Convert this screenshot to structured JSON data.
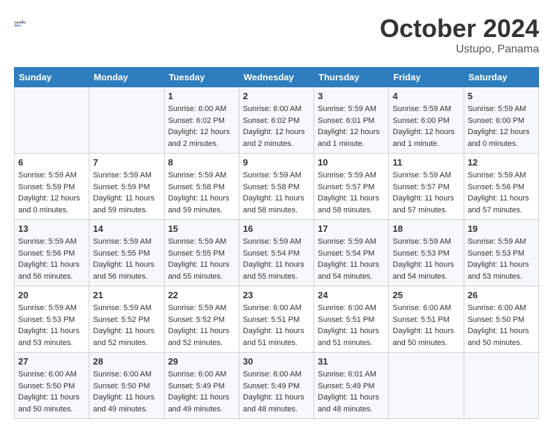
{
  "header": {
    "logo_general": "General",
    "logo_blue": "Blue",
    "month_year": "October 2024",
    "location": "Ustupo, Panama"
  },
  "days_of_week": [
    "Sunday",
    "Monday",
    "Tuesday",
    "Wednesday",
    "Thursday",
    "Friday",
    "Saturday"
  ],
  "weeks": [
    [
      {
        "day": "",
        "sunrise": "",
        "sunset": "",
        "daylight": ""
      },
      {
        "day": "",
        "sunrise": "",
        "sunset": "",
        "daylight": ""
      },
      {
        "day": "1",
        "sunrise": "Sunrise: 6:00 AM",
        "sunset": "Sunset: 6:02 PM",
        "daylight": "Daylight: 12 hours and 2 minutes."
      },
      {
        "day": "2",
        "sunrise": "Sunrise: 6:00 AM",
        "sunset": "Sunset: 6:02 PM",
        "daylight": "Daylight: 12 hours and 2 minutes."
      },
      {
        "day": "3",
        "sunrise": "Sunrise: 5:59 AM",
        "sunset": "Sunset: 6:01 PM",
        "daylight": "Daylight: 12 hours and 1 minute."
      },
      {
        "day": "4",
        "sunrise": "Sunrise: 5:59 AM",
        "sunset": "Sunset: 6:00 PM",
        "daylight": "Daylight: 12 hours and 1 minute."
      },
      {
        "day": "5",
        "sunrise": "Sunrise: 5:59 AM",
        "sunset": "Sunset: 6:00 PM",
        "daylight": "Daylight: 12 hours and 0 minutes."
      }
    ],
    [
      {
        "day": "6",
        "sunrise": "Sunrise: 5:59 AM",
        "sunset": "Sunset: 5:59 PM",
        "daylight": "Daylight: 12 hours and 0 minutes."
      },
      {
        "day": "7",
        "sunrise": "Sunrise: 5:59 AM",
        "sunset": "Sunset: 5:59 PM",
        "daylight": "Daylight: 11 hours and 59 minutes."
      },
      {
        "day": "8",
        "sunrise": "Sunrise: 5:59 AM",
        "sunset": "Sunset: 5:58 PM",
        "daylight": "Daylight: 11 hours and 59 minutes."
      },
      {
        "day": "9",
        "sunrise": "Sunrise: 5:59 AM",
        "sunset": "Sunset: 5:58 PM",
        "daylight": "Daylight: 11 hours and 58 minutes."
      },
      {
        "day": "10",
        "sunrise": "Sunrise: 5:59 AM",
        "sunset": "Sunset: 5:57 PM",
        "daylight": "Daylight: 11 hours and 58 minutes."
      },
      {
        "day": "11",
        "sunrise": "Sunrise: 5:59 AM",
        "sunset": "Sunset: 5:57 PM",
        "daylight": "Daylight: 11 hours and 57 minutes."
      },
      {
        "day": "12",
        "sunrise": "Sunrise: 5:59 AM",
        "sunset": "Sunset: 5:56 PM",
        "daylight": "Daylight: 11 hours and 57 minutes."
      }
    ],
    [
      {
        "day": "13",
        "sunrise": "Sunrise: 5:59 AM",
        "sunset": "Sunset: 5:56 PM",
        "daylight": "Daylight: 11 hours and 56 minutes."
      },
      {
        "day": "14",
        "sunrise": "Sunrise: 5:59 AM",
        "sunset": "Sunset: 5:55 PM",
        "daylight": "Daylight: 11 hours and 56 minutes."
      },
      {
        "day": "15",
        "sunrise": "Sunrise: 5:59 AM",
        "sunset": "Sunset: 5:55 PM",
        "daylight": "Daylight: 11 hours and 55 minutes."
      },
      {
        "day": "16",
        "sunrise": "Sunrise: 5:59 AM",
        "sunset": "Sunset: 5:54 PM",
        "daylight": "Daylight: 11 hours and 55 minutes."
      },
      {
        "day": "17",
        "sunrise": "Sunrise: 5:59 AM",
        "sunset": "Sunset: 5:54 PM",
        "daylight": "Daylight: 11 hours and 54 minutes."
      },
      {
        "day": "18",
        "sunrise": "Sunrise: 5:59 AM",
        "sunset": "Sunset: 5:53 PM",
        "daylight": "Daylight: 11 hours and 54 minutes."
      },
      {
        "day": "19",
        "sunrise": "Sunrise: 5:59 AM",
        "sunset": "Sunset: 5:53 PM",
        "daylight": "Daylight: 11 hours and 53 minutes."
      }
    ],
    [
      {
        "day": "20",
        "sunrise": "Sunrise: 5:59 AM",
        "sunset": "Sunset: 5:53 PM",
        "daylight": "Daylight: 11 hours and 53 minutes."
      },
      {
        "day": "21",
        "sunrise": "Sunrise: 5:59 AM",
        "sunset": "Sunset: 5:52 PM",
        "daylight": "Daylight: 11 hours and 52 minutes."
      },
      {
        "day": "22",
        "sunrise": "Sunrise: 5:59 AM",
        "sunset": "Sunset: 5:52 PM",
        "daylight": "Daylight: 11 hours and 52 minutes."
      },
      {
        "day": "23",
        "sunrise": "Sunrise: 6:00 AM",
        "sunset": "Sunset: 5:51 PM",
        "daylight": "Daylight: 11 hours and 51 minutes."
      },
      {
        "day": "24",
        "sunrise": "Sunrise: 6:00 AM",
        "sunset": "Sunset: 5:51 PM",
        "daylight": "Daylight: 11 hours and 51 minutes."
      },
      {
        "day": "25",
        "sunrise": "Sunrise: 6:00 AM",
        "sunset": "Sunset: 5:51 PM",
        "daylight": "Daylight: 11 hours and 50 minutes."
      },
      {
        "day": "26",
        "sunrise": "Sunrise: 6:00 AM",
        "sunset": "Sunset: 5:50 PM",
        "daylight": "Daylight: 11 hours and 50 minutes."
      }
    ],
    [
      {
        "day": "27",
        "sunrise": "Sunrise: 6:00 AM",
        "sunset": "Sunset: 5:50 PM",
        "daylight": "Daylight: 11 hours and 50 minutes."
      },
      {
        "day": "28",
        "sunrise": "Sunrise: 6:00 AM",
        "sunset": "Sunset: 5:50 PM",
        "daylight": "Daylight: 11 hours and 49 minutes."
      },
      {
        "day": "29",
        "sunrise": "Sunrise: 6:00 AM",
        "sunset": "Sunset: 5:49 PM",
        "daylight": "Daylight: 11 hours and 49 minutes."
      },
      {
        "day": "30",
        "sunrise": "Sunrise: 6:00 AM",
        "sunset": "Sunset: 5:49 PM",
        "daylight": "Daylight: 11 hours and 48 minutes."
      },
      {
        "day": "31",
        "sunrise": "Sunrise: 6:01 AM",
        "sunset": "Sunset: 5:49 PM",
        "daylight": "Daylight: 11 hours and 48 minutes."
      },
      {
        "day": "",
        "sunrise": "",
        "sunset": "",
        "daylight": ""
      },
      {
        "day": "",
        "sunrise": "",
        "sunset": "",
        "daylight": ""
      }
    ]
  ]
}
